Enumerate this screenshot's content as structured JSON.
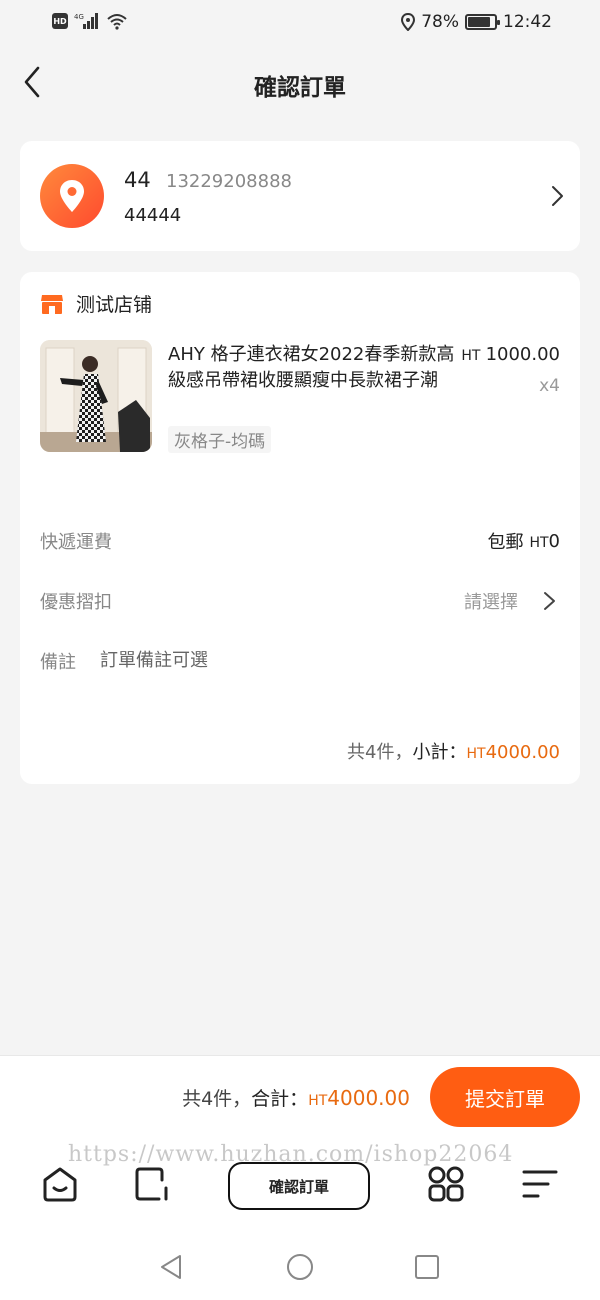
{
  "status_bar": {
    "network": "4G",
    "battery_text": "78%",
    "battery_level": 0.78,
    "time": "12:42"
  },
  "header": {
    "title": "確認訂單"
  },
  "address": {
    "name": "44",
    "phone": "13229208888",
    "detail": "44444"
  },
  "shop": {
    "name": "测试店铺"
  },
  "product": {
    "title": "AHY 格子連衣裙女2022春季新款高級感吊帶裙收腰顯瘦中長款裙子潮",
    "spec": "灰格子-均碼",
    "currency": "HT",
    "price": "1000.00",
    "qty": "x4"
  },
  "rows": {
    "shipping_label": "快遞運費",
    "shipping_value": "包郵",
    "shipping_currency": "HT",
    "shipping_amount": "0",
    "discount_label": "優惠摺扣",
    "discount_value": "請選擇",
    "note_label": "備註",
    "note_placeholder": "訂單備註可選"
  },
  "subtotal": {
    "count_text": "共4件，",
    "label": "小計：",
    "currency": "HT",
    "amount": "4000.00"
  },
  "bottom": {
    "count_text": "共4件，",
    "label": "合計：",
    "currency": "HT",
    "amount": "4000.00",
    "submit_label": "提交訂單",
    "watermark": "https://www.huzhan.com/ishop22064"
  },
  "nav": {
    "center_label": "確認訂單"
  },
  "colors": {
    "accent": "#ff5d12",
    "price": "#e86a10"
  }
}
